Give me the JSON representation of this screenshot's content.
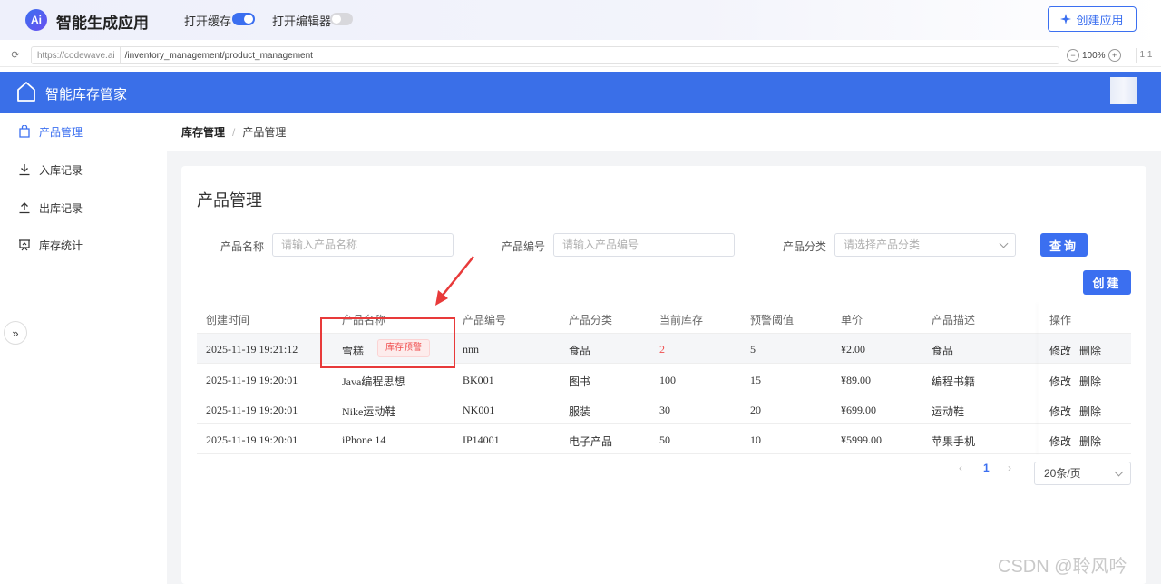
{
  "app": {
    "logo_text": "Ai",
    "title": "智能生成应用"
  },
  "toggles": [
    {
      "label": "打开缓存",
      "on": true
    },
    {
      "label": "打开编辑器",
      "on": false
    }
  ],
  "create_app_label": "创建应用",
  "url": {
    "host": "https://codewave.ai",
    "path": "/inventory_management/product_management",
    "zoom": "100%",
    "ratio": "1:1"
  },
  "header": {
    "title": "智能库存管家"
  },
  "sidebar": {
    "items": [
      {
        "label": "产品管理",
        "icon": "bag-icon",
        "active": true
      },
      {
        "label": "入库记录",
        "icon": "download-icon",
        "active": false
      },
      {
        "label": "出库记录",
        "icon": "upload-icon",
        "active": false
      },
      {
        "label": "库存统计",
        "icon": "chart-board-icon",
        "active": false
      }
    ]
  },
  "breadcrumb": {
    "root": "库存管理",
    "separator": "/",
    "current": "产品管理"
  },
  "page_title": "产品管理",
  "filters": {
    "name": {
      "label": "产品名称",
      "placeholder": "请输入产品名称"
    },
    "code": {
      "label": "产品编号",
      "placeholder": "请输入产品编号"
    },
    "category": {
      "label": "产品分类",
      "placeholder": "请选择产品分类"
    },
    "query_label": "查询",
    "create_label": "创建"
  },
  "table": {
    "columns": [
      "创建时间",
      "产品名称",
      "产品编号",
      "产品分类",
      "当前库存",
      "预警阈值",
      "单价",
      "产品描述",
      "操作"
    ],
    "rows": [
      {
        "created": "2025-11-19 19:21:12",
        "name": "雪糕",
        "tag": "库存预警",
        "code": "nnn",
        "category": "食品",
        "stock": "2",
        "threshold": "5",
        "price": "¥2.00",
        "desc": "食品",
        "edit": "修改",
        "delete": "删除"
      },
      {
        "created": "2025-11-19 19:20:01",
        "name": "Java编程思想",
        "code": "BK001",
        "category": "图书",
        "stock": "100",
        "threshold": "15",
        "price": "¥89.00",
        "desc": "编程书籍",
        "edit": "修改",
        "delete": "删除"
      },
      {
        "created": "2025-11-19 19:20:01",
        "name": "Nike运动鞋",
        "code": "NK001",
        "category": "服装",
        "stock": "30",
        "threshold": "20",
        "price": "¥699.00",
        "desc": "运动鞋",
        "edit": "修改",
        "delete": "删除"
      },
      {
        "created": "2025-11-19 19:20:01",
        "name": "iPhone 14",
        "code": "IP14001",
        "category": "电子产品",
        "stock": "50",
        "threshold": "10",
        "price": "¥5999.00",
        "desc": "苹果手机",
        "edit": "修改",
        "delete": "删除"
      }
    ]
  },
  "pagination": {
    "prev": "‹",
    "page": "1",
    "next": "›",
    "page_size": "20条/页"
  },
  "watermark": "CSDN @聆风吟",
  "colors": {
    "primary": "#3b6ff0",
    "header": "#3a6fe8",
    "warning": "#f05050",
    "annotation": "#e83a3a"
  }
}
